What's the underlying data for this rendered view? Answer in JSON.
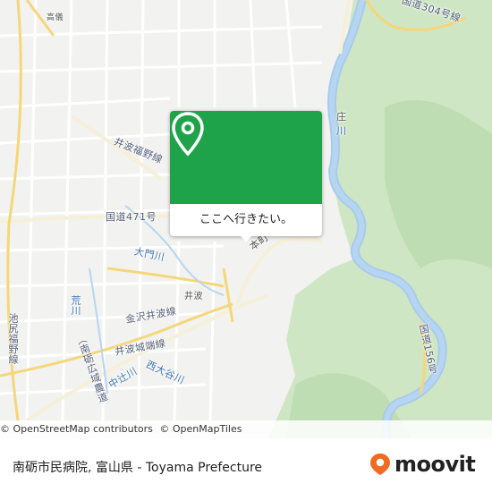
{
  "map": {
    "labels": {
      "top_left_small": "高儀",
      "route_top_right": "国道304号線",
      "route_top_right_short": "国道304号",
      "shou": "庄",
      "shou_river": "川",
      "inami_fukuno_line": "井波福野線",
      "route_471": "国道471号",
      "honmachi": "本町",
      "omon_river": "大門川",
      "inami": "井波",
      "kanazawa_inami_line": "金沢井波線",
      "ara_river": "荒川",
      "ikejiri_fukuno_line": "池尻福野線",
      "inami_joutan_line": "井波城端線",
      "joutan_agri_road": "（南砺広域農道",
      "nakashiro_river": "中辻川",
      "nishi_oyabe_river": "西大谷川",
      "route_156": "国道156号"
    },
    "popup": {
      "cta_label": "ここへ行きたい。",
      "pin_color": "#1fa34a"
    },
    "attribution": {
      "osm": "© OpenStreetMap contributors",
      "omt": "© OpenMapTiles"
    }
  },
  "footer": {
    "title": "南砺市民病院, 富山県 - Toyama Prefecture",
    "logo_text": "moovit",
    "logo_color": "#f26a21"
  }
}
